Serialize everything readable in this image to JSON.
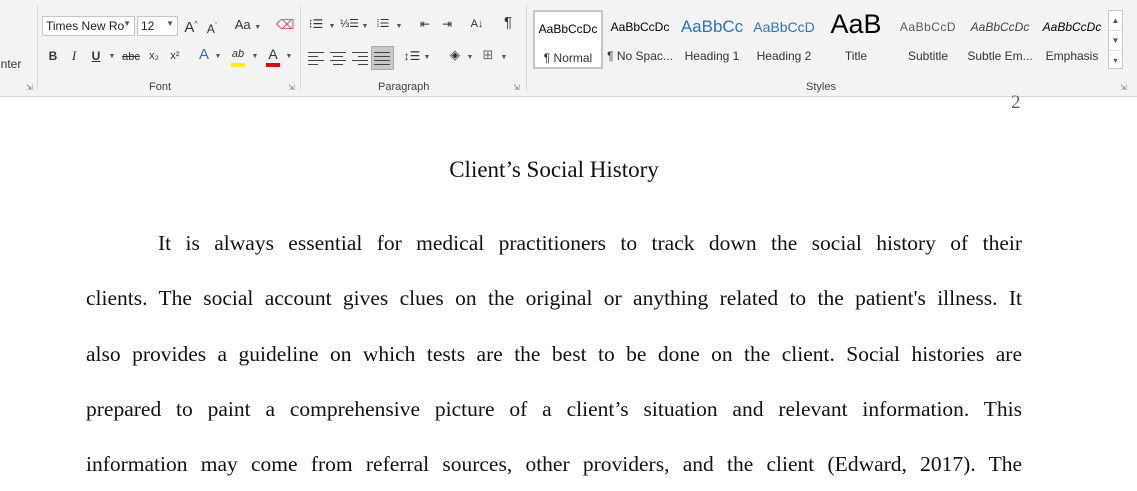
{
  "ribbon": {
    "format_painter_label": "inter",
    "font": {
      "group_label": "Font",
      "font_name": "Times New Ro",
      "font_size": "12",
      "grow_label": "A",
      "shrink_label": "A",
      "case_label": "Aa",
      "bold": "B",
      "italic": "I",
      "underline": "U",
      "strike": "abc",
      "subscript": "x₂",
      "superscript": "x²",
      "effects": "A",
      "highlight": "ab",
      "font_color": "A",
      "highlight_color": "#ffef00",
      "font_color_value": "#e00000"
    },
    "paragraph": {
      "group_label": "Paragraph",
      "pilcrow": "¶",
      "sort": "A↓"
    },
    "styles": {
      "group_label": "Styles",
      "items": [
        {
          "sample": "AaBbCcDc",
          "name": "¶ Normal"
        },
        {
          "sample": "AaBbCcDc",
          "name": "¶ No Spac..."
        },
        {
          "sample": "AaBbCc",
          "name": "Heading 1"
        },
        {
          "sample": "AaBbCcD",
          "name": "Heading 2"
        },
        {
          "sample": "AaB",
          "name": "Title"
        },
        {
          "sample": "AaBbCcD",
          "name": "Subtitle"
        },
        {
          "sample": "AaBbCcDc",
          "name": "Subtle Em..."
        },
        {
          "sample": "AaBbCcDc",
          "name": "Emphasis"
        }
      ]
    }
  },
  "document": {
    "page_number": "2",
    "title": "Client’s Social History",
    "lines": [
      "It is always essential for medical practitioners to track down the social history of their",
      "clients. The social account gives clues on the original or anything related to the patient's illness. It",
      "also provides a guideline on which tests are the best to be done on the client. Social histories are",
      "prepared to paint a comprehensive picture of a client’s situation and relevant information. This",
      "information may come from referral sources, other providers, and the client (Edward, 2017). The"
    ]
  }
}
